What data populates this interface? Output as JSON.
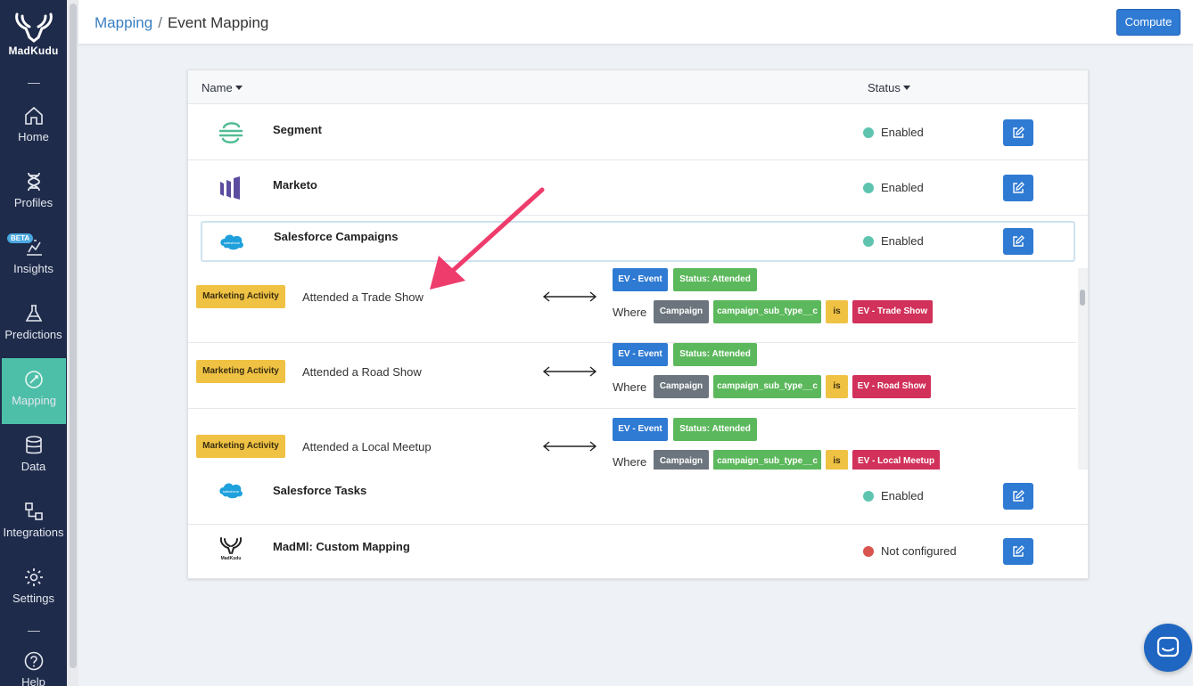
{
  "sidebar": {
    "logo_text": "MadKudu",
    "items": [
      {
        "label": "Home",
        "icon": "home-icon"
      },
      {
        "label": "Profiles",
        "icon": "dna-icon"
      },
      {
        "label": "Insights",
        "icon": "chart-icon",
        "badge": "BETA"
      },
      {
        "label": "Predictions",
        "icon": "flask-icon"
      },
      {
        "label": "Mapping",
        "icon": "mapping-icon",
        "active": true
      },
      {
        "label": "Data",
        "icon": "database-icon"
      },
      {
        "label": "Integrations",
        "icon": "integrations-icon"
      },
      {
        "label": "Settings",
        "icon": "gear-icon"
      },
      {
        "label": "Help",
        "icon": "help-icon"
      }
    ]
  },
  "header": {
    "breadcrumb": {
      "parent": "Mapping",
      "separator": "/",
      "current": "Event Mapping"
    },
    "compute_label": "Compute"
  },
  "table": {
    "columns": {
      "name": "Name",
      "status": "Status"
    },
    "rows": [
      {
        "name": "Segment",
        "status": "Enabled",
        "status_color": "#5ec4b0",
        "logo": "segment-logo"
      },
      {
        "name": "Marketo",
        "status": "Enabled",
        "status_color": "#5ec4b0",
        "logo": "marketo-logo"
      },
      {
        "name": "Salesforce Campaigns",
        "status": "Enabled",
        "status_color": "#5ec4b0",
        "logo": "salesforce-logo",
        "logo_text": "salesforce"
      },
      {
        "name": "Salesforce Tasks",
        "status": "Enabled",
        "status_color": "#5ec4b0",
        "logo": "salesforce-logo",
        "logo_text": "salesforce"
      },
      {
        "name": "MadMl: Custom Mapping",
        "status": "Not configured",
        "status_color": "#d9534f",
        "logo": "madkudu-logo",
        "logo_text": "MadKudu"
      }
    ]
  },
  "mappings": [
    {
      "type": "Marketing Activity",
      "name": "Attended a Trade Show",
      "event": "EV - Event",
      "status": "Status: Attended",
      "where": "Where",
      "field_obj": "Campaign",
      "field": "campaign_sub_type__c",
      "op": "is",
      "value": "EV - Trade Show"
    },
    {
      "type": "Marketing Activity",
      "name": "Attended a Road Show",
      "event": "EV - Event",
      "status": "Status: Attended",
      "where": "Where",
      "field_obj": "Campaign",
      "field": "campaign_sub_type__c",
      "op": "is",
      "value": "EV - Road Show"
    },
    {
      "type": "Marketing Activity",
      "name": "Attended a Local Meetup",
      "event": "EV - Event",
      "status": "Status: Attended",
      "where": "Where",
      "field_obj": "Campaign",
      "field": "campaign_sub_type__c",
      "op": "is",
      "value": "EV - Local Meetup"
    }
  ],
  "colors": {
    "sidebar_bg": "#1f2b4a",
    "active": "#4dbfa8",
    "primary": "#2f7ad3",
    "annotation": "#ee3c6c"
  }
}
